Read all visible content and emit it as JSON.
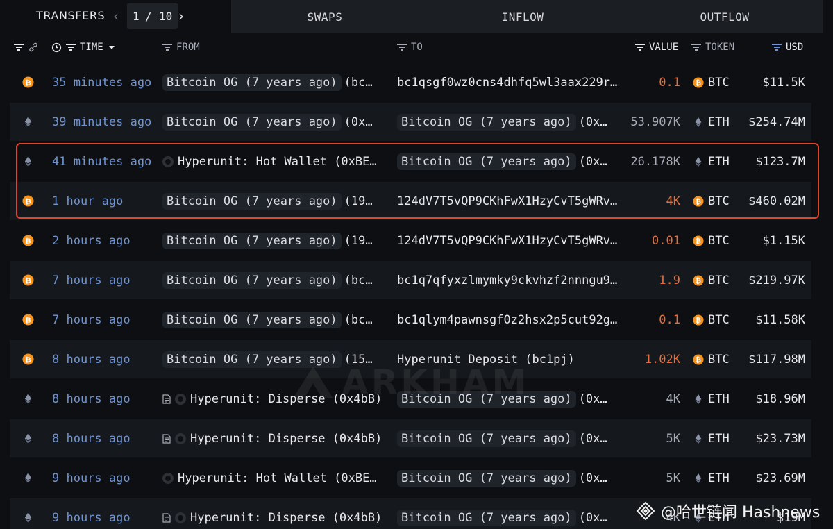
{
  "tabs": {
    "transfers": "TRANSFERS",
    "page_current": "1",
    "page_sep": "/",
    "page_total": "10",
    "swaps": "SWAPS",
    "inflow": "INFLOW",
    "outflow": "OUTFLOW"
  },
  "columns": {
    "time": "TIME",
    "from": "FROM",
    "to": "TO",
    "value": "VALUE",
    "token": "TOKEN",
    "usd": "USD"
  },
  "colors": {
    "btc": "#f7931a",
    "eth": "#8a92a6",
    "highlight": "#e0462a",
    "time_link": "#6e94d6",
    "value_orange": "#e0703f"
  },
  "rows": [
    {
      "chain": "btc-icon",
      "time": "35 minutes ago",
      "from_name": "Bitcoin OG (7 years ago)",
      "from_addr": "(bc…",
      "to_name": "",
      "to_addr": "bc1qsgf0wz0cns4dhfq5wl3aax229r…",
      "value": "0.1",
      "token": "BTC",
      "usd": "$11.5K"
    },
    {
      "chain": "eth-icon",
      "time": "39 minutes ago",
      "from_name": "Bitcoin OG (7 years ago)",
      "from_addr": "(0x…",
      "to_name": "Bitcoin OG (7 years ago)",
      "to_addr": "(0x…",
      "value": "53.907K",
      "token": "ETH",
      "usd": "$254.74M"
    },
    {
      "chain": "eth-icon",
      "time": "41 minutes ago",
      "from_name": "Hyperunit: Hot Wallet (0xBE…",
      "from_addr": "",
      "to_name": "Bitcoin OG (7 years ago)",
      "to_addr": "(0x…",
      "value": "26.178K",
      "token": "ETH",
      "usd": "$123.7M"
    },
    {
      "chain": "btc-icon",
      "time": "1 hour ago",
      "from_name": "Bitcoin OG (7 years ago)",
      "from_addr": "(19…",
      "to_name": "",
      "to_addr": "124dV7T5vQP9CKhFwX1HzyCvT5gWRv…",
      "value": "4K",
      "token": "BTC",
      "usd": "$460.02M"
    },
    {
      "chain": "btc-icon",
      "time": "2 hours ago",
      "from_name": "Bitcoin OG (7 years ago)",
      "from_addr": "(19…",
      "to_name": "",
      "to_addr": "124dV7T5vQP9CKhFwX1HzyCvT5gWRv…",
      "value": "0.01",
      "token": "BTC",
      "usd": "$1.15K"
    },
    {
      "chain": "btc-icon",
      "time": "7 hours ago",
      "from_name": "Bitcoin OG (7 years ago)",
      "from_addr": "(bc…",
      "to_name": "",
      "to_addr": "bc1q7qfyxzlmymky9ckvhzf2nnngu9…",
      "value": "1.9",
      "token": "BTC",
      "usd": "$219.97K"
    },
    {
      "chain": "btc-icon",
      "time": "7 hours ago",
      "from_name": "Bitcoin OG (7 years ago)",
      "from_addr": "(bc…",
      "to_name": "",
      "to_addr": "bc1qlym4pawnsgf0z2hsx2p5cut92g…",
      "value": "0.1",
      "token": "BTC",
      "usd": "$11.58K"
    },
    {
      "chain": "btc-icon",
      "time": "8 hours ago",
      "from_name": "Bitcoin OG (7 years ago)",
      "from_addr": "(15…",
      "to_name": "",
      "to_addr": "Hyperunit Deposit (bc1pj)",
      "value": "1.02K",
      "token": "BTC",
      "usd": "$117.98M"
    },
    {
      "chain": "eth-icon",
      "time": "8 hours ago",
      "from_name": "Hyperunit: Disperse (0x4bB)",
      "from_addr": "",
      "to_name": "Bitcoin OG (7 years ago)",
      "to_addr": "(0x…",
      "value": "4K",
      "token": "ETH",
      "usd": "$18.96M"
    },
    {
      "chain": "eth-icon",
      "time": "8 hours ago",
      "from_name": "Hyperunit: Disperse (0x4bB)",
      "from_addr": "",
      "to_name": "Bitcoin OG (7 years ago)",
      "to_addr": "(0x…",
      "value": "5K",
      "token": "ETH",
      "usd": "$23.73M"
    },
    {
      "chain": "eth-icon",
      "time": "9 hours ago",
      "from_name": "Hyperunit: Hot Wallet (0xBE…",
      "from_addr": "",
      "to_name": "Bitcoin OG (7 years ago)",
      "to_addr": "(0x…",
      "value": "5K",
      "token": "ETH",
      "usd": "$23.69M"
    },
    {
      "chain": "eth-icon",
      "time": "9 hours ago",
      "from_name": "Hyperunit: Disperse (0x4bB)",
      "from_addr": "",
      "to_name": "Bitcoin OG (7 years ago)",
      "to_addr": "(0x…",
      "value": "4K",
      "token": "ETH",
      "usd": "$19M"
    }
  ],
  "watermark": {
    "brand": "ARKHAM",
    "source": "@哈世链闻 Hashnews"
  }
}
